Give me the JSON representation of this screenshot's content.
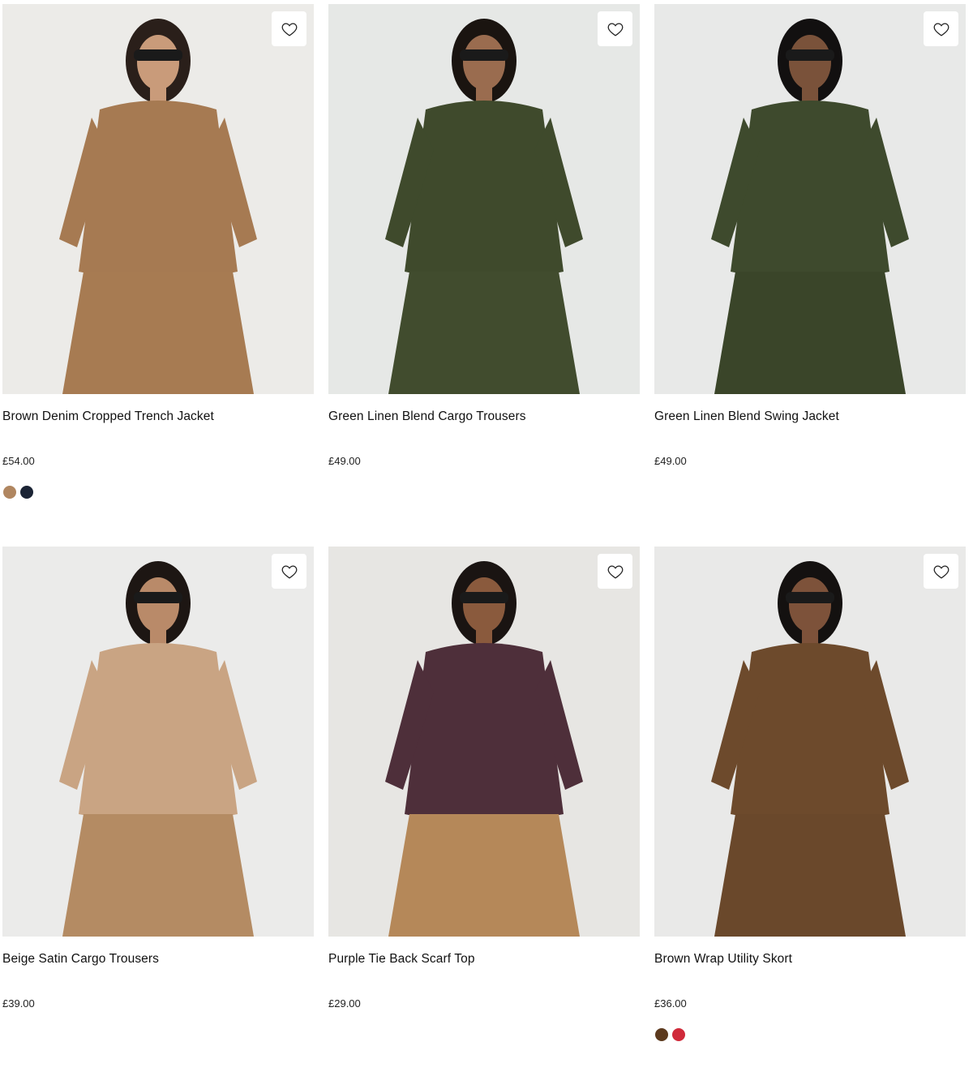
{
  "products": [
    {
      "name": "Brown Denim Cropped Trench Jacket",
      "price": "£54.00",
      "wishlist_icon": "heart-outline-icon",
      "bg": "#ecebe8",
      "garment": "#a67a52",
      "lower": "#a77b52",
      "skin": "#c99b7a",
      "hair": "#2a1f1a",
      "swatches": [
        "#b08660",
        "#1b2435"
      ]
    },
    {
      "name": "Green Linen Blend Cargo Trousers",
      "price": "£49.00",
      "wishlist_icon": "heart-outline-icon",
      "bg": "#e6e8e6",
      "garment": "#3f4a2c",
      "lower": "#414c2e",
      "skin": "#9a6c4f",
      "hair": "#1a1410",
      "swatches": []
    },
    {
      "name": "Green Linen Blend Swing Jacket",
      "price": "£49.00",
      "wishlist_icon": "heart-outline-icon",
      "bg": "#e8e9e8",
      "garment": "#3e4a2d",
      "lower": "#3a4529",
      "skin": "#7a523a",
      "hair": "#121010",
      "swatches": []
    },
    {
      "name": "Beige Satin Cargo Trousers",
      "price": "£39.00",
      "wishlist_icon": "heart-outline-icon",
      "bg": "#ebebea",
      "garment": "#c9a483",
      "lower": "#b48b63",
      "skin": "#b98a69",
      "hair": "#1d1613",
      "swatches": []
    },
    {
      "name": "Purple Tie Back Scarf Top",
      "price": "£29.00",
      "wishlist_icon": "heart-outline-icon",
      "bg": "#e7e6e3",
      "garment": "#4e2f3a",
      "lower": "#b58859",
      "skin": "#8a5a3d",
      "hair": "#1a1412",
      "swatches": []
    },
    {
      "name": "Brown Wrap Utility Skort",
      "price": "£36.00",
      "wishlist_icon": "heart-outline-icon",
      "bg": "#e9e9e8",
      "garment": "#6d4a2c",
      "lower": "#6a482b",
      "skin": "#7d523a",
      "hair": "#141110",
      "swatches": [
        "#5c3a1e",
        "#d02a3a"
      ]
    }
  ]
}
